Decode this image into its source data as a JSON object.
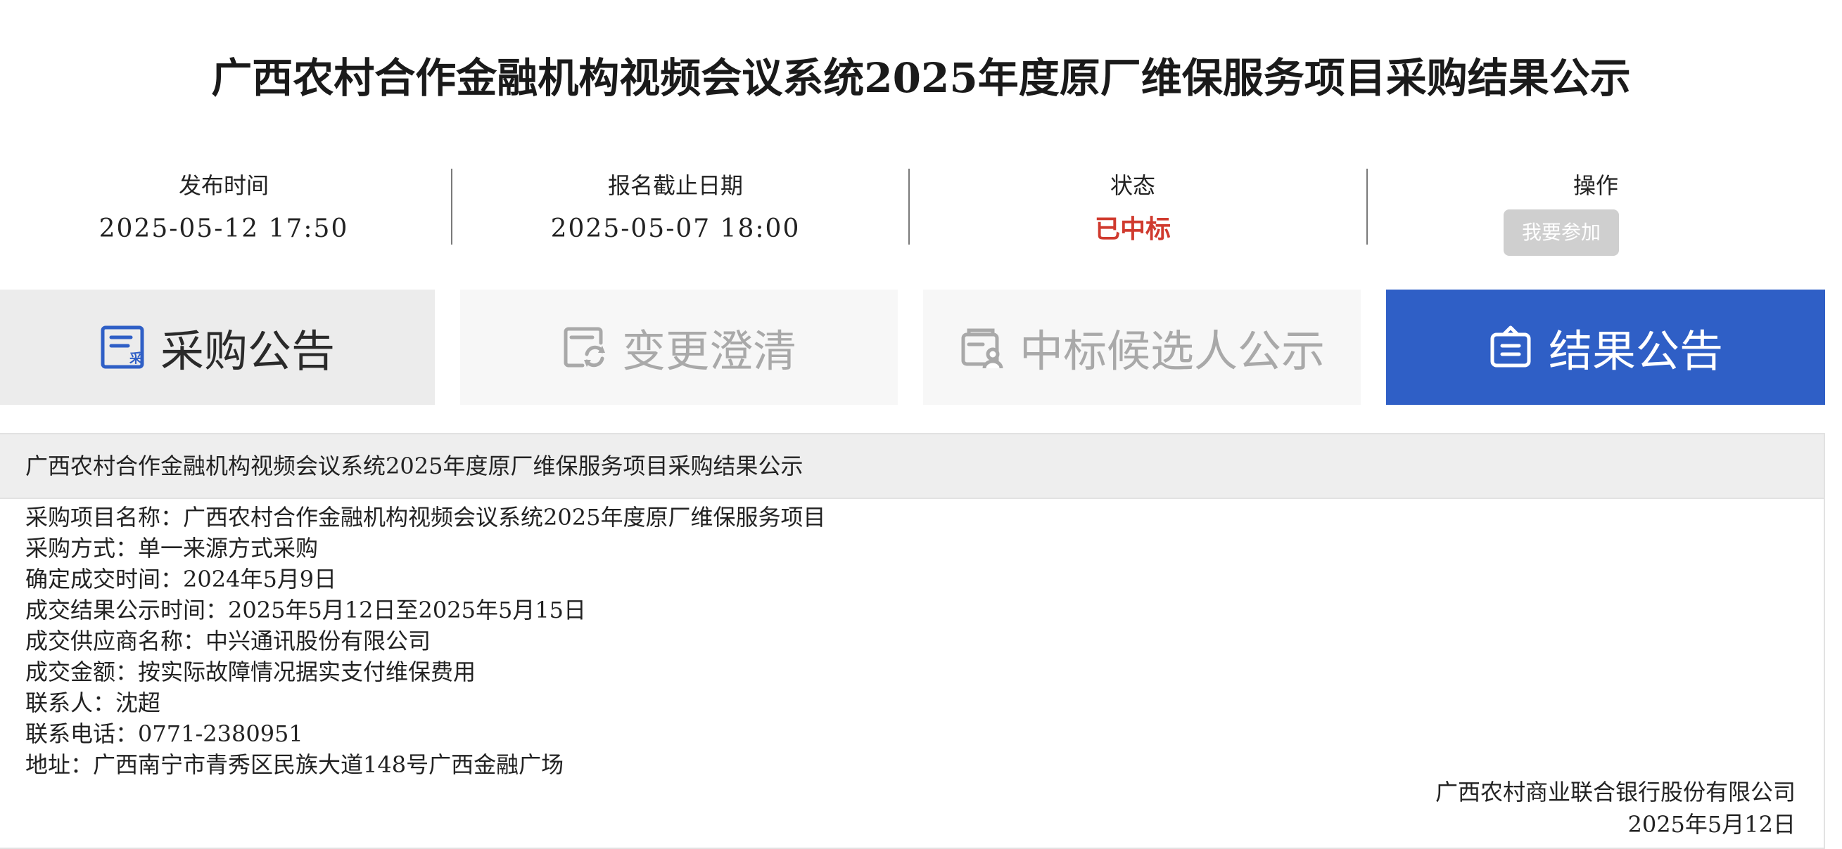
{
  "page": {
    "title": "广西农村合作金融机构视频会议系统2025年度原厂维保服务项目采购结果公示"
  },
  "info": {
    "publish": {
      "label": "发布时间",
      "value": "2025-05-12 17:50"
    },
    "deadline": {
      "label": "报名截止日期",
      "value": "2025-05-07 18:00"
    },
    "status": {
      "label": "状态",
      "value": "已中标",
      "color": "#d03a2e"
    },
    "action": {
      "label": "操作",
      "button_label": "我要参加"
    }
  },
  "tabs": [
    {
      "label": "采购公告",
      "icon": "procurement-doc-icon",
      "active": false
    },
    {
      "label": "变更澄清",
      "icon": "change-doc-icon",
      "active": false
    },
    {
      "label": "中标候选人公示",
      "icon": "candidate-icon",
      "active": false
    },
    {
      "label": "结果公告",
      "icon": "clipboard-icon",
      "active": true
    }
  ],
  "colors": {
    "accent": "#2f5fc6",
    "status_red": "#d03a2e",
    "disabled_button": "#cfcfcf"
  },
  "content": {
    "header_title": "广西农村合作金融机构视频会议系统2025年度原厂维保服务项目采购结果公示",
    "lines": [
      "采购项目名称：广西农村合作金融机构视频会议系统2025年度原厂维保服务项目",
      "采购方式：单一来源方式采购",
      "确定成交时间：2024年5月9日",
      "成交结果公示时间：2025年5月12日至2025年5月15日",
      "成交供应商名称：中兴通讯股份有限公司",
      "成交金额：按实际故障情况据实支付维保费用",
      "联系人：沈超",
      "联系电话：0771-2380951",
      "地址：广西南宁市青秀区民族大道148号广西金融广场"
    ],
    "signature": {
      "org": "广西农村商业联合银行股份有限公司",
      "date": "2025年5月12日"
    }
  }
}
